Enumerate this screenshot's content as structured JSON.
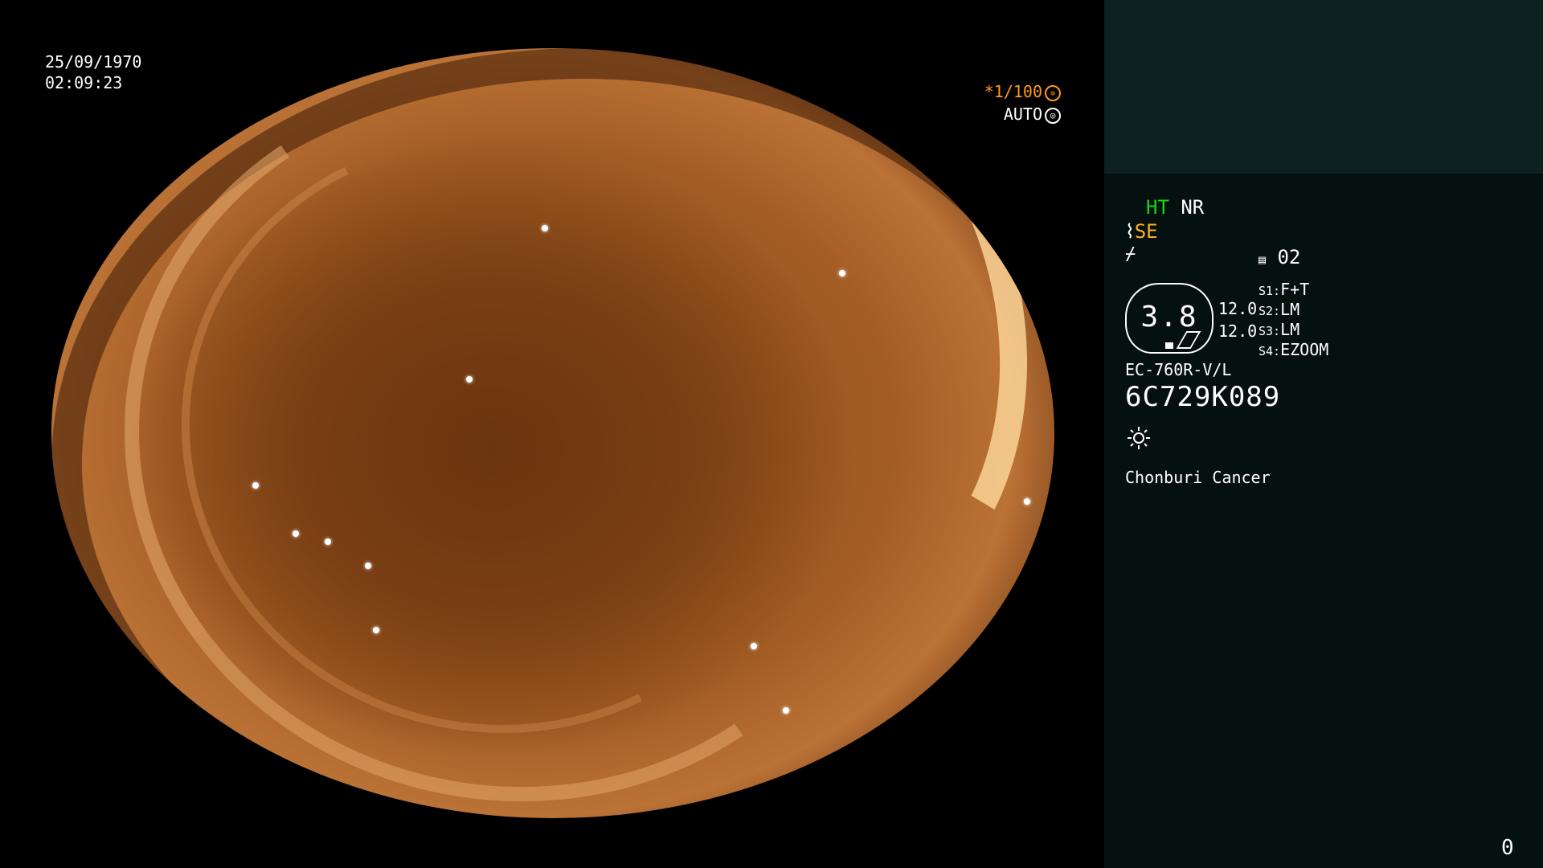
{
  "overlay": {
    "date": "25/09/1970",
    "time": "02:09:23",
    "shutter": "*1/100",
    "shutter_icon": "shutter-icon",
    "iris": "AUTO",
    "iris_icon": "iris-icon"
  },
  "panel": {
    "ht": "HT",
    "nr": "NR",
    "se": "SE",
    "se_icon": "scope-icon",
    "settings_icon": "enhance-icon",
    "memory_icon": "memory-icon",
    "memory": "02",
    "value": "3.8",
    "num1": "12.0",
    "num2": "12.0",
    "s1_label": "S1:",
    "s1": "F+T",
    "s2_label": "S2:",
    "s2": "LM",
    "s3_label": "S3:",
    "s3": "LM",
    "s4_label": "S4:",
    "s4": "EZOOM",
    "model": "EC-760R-V/L",
    "serial": "6C729K089",
    "light_icon": "sun-icon",
    "hospital": "Chonburi Cancer",
    "counter": "0"
  },
  "colors": {
    "green": "#19d41b",
    "yellow": "#ffb020",
    "orange": "#ff9a1a",
    "panel": "#051110"
  }
}
